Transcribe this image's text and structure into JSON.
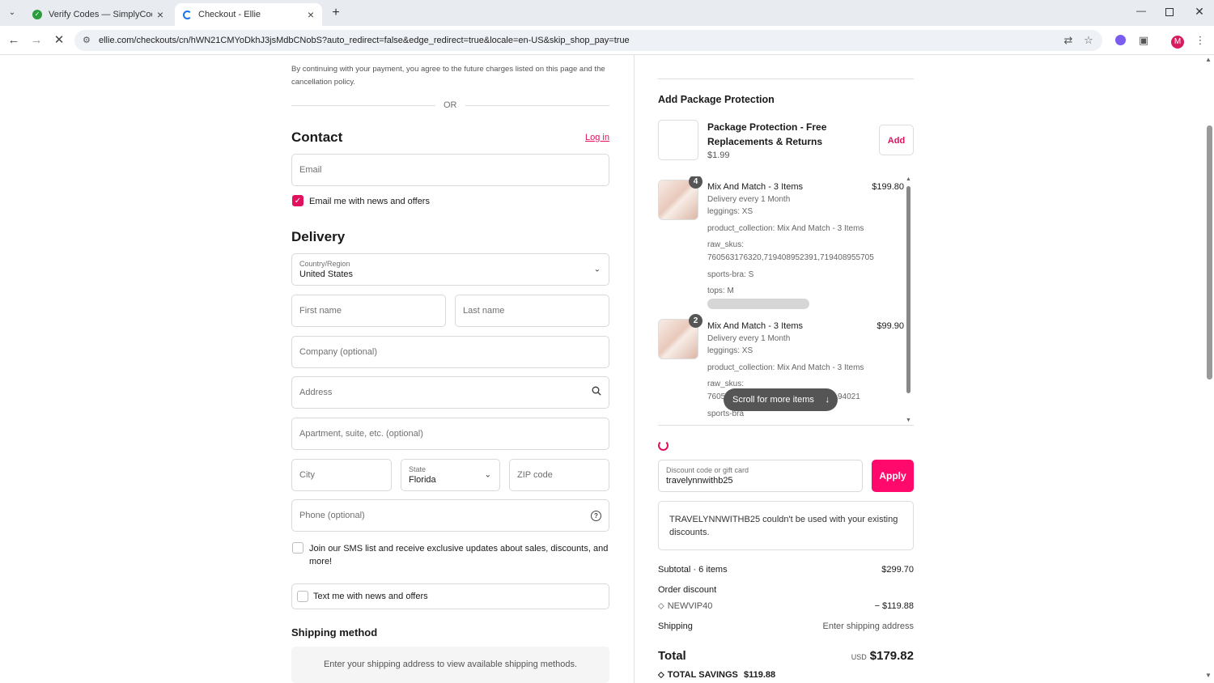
{
  "tabs": [
    {
      "title": "Verify Codes — SimplyCodes",
      "active": false
    },
    {
      "title": "Checkout - Ellie",
      "active": true
    }
  ],
  "url": "ellie.com/checkouts/cn/hWN21CMYoDkhJ3jsMdbCNobS?auto_redirect=false&edge_redirect=true&locale=en-US&skip_shop_pay=true",
  "profile_initial": "M",
  "colors": {
    "accent": "#e0115f",
    "apply_button": "#ff0a6c"
  },
  "left": {
    "consent_text": "By continuing with your payment, you agree to the future charges listed on this page and the cancellation policy.",
    "or_text": "OR",
    "contact": {
      "heading": "Contact",
      "login_link": "Log in",
      "email_placeholder": "Email",
      "email_news_label": "Email me with news and offers",
      "email_news_checked": true
    },
    "delivery": {
      "heading": "Delivery",
      "country_label": "Country/Region",
      "country_value": "United States",
      "first_name_placeholder": "First name",
      "last_name_placeholder": "Last name",
      "company_placeholder": "Company (optional)",
      "address_placeholder": "Address",
      "apartment_placeholder": "Apartment, suite, etc. (optional)",
      "city_placeholder": "City",
      "state_label": "State",
      "state_value": "Florida",
      "zip_placeholder": "ZIP code",
      "phone_placeholder": "Phone (optional)",
      "sms_label": "Join our SMS list and receive exclusive updates about sales, discounts, and more!",
      "text_news_label": "Text me with news and offers"
    },
    "shipping": {
      "heading": "Shipping method",
      "notice": "Enter your shipping address to view available shipping methods."
    }
  },
  "right": {
    "protection": {
      "heading": "Add Package Protection",
      "title": "Package Protection - Free Replacements & Returns",
      "price": "$1.99",
      "add_label": "Add"
    },
    "items": [
      {
        "qty": "4",
        "title": "Mix And Match - 3 Items",
        "price": "$199.80",
        "delivery": "Delivery every 1 Month",
        "leggings": "leggings: XS",
        "collection": "product_collection: Mix And Match - 3 Items",
        "raw_skus_label": "raw_skus:",
        "raw_skus": "760563176320,719408952391,719408955705",
        "sports_bra": "sports-bra: S",
        "tops": "tops: M"
      },
      {
        "qty": "2",
        "title": "Mix And Match - 3 Items",
        "price": "$99.90",
        "delivery": "Delivery every 1 Month",
        "leggings": "leggings: XS",
        "collection": "product_collection: Mix And Match - 3 Items",
        "raw_skus_label": "raw_skus:",
        "raw_skus_start": "7605",
        "raw_skus_end": "94021",
        "sports_bra_partial": "sports-bra"
      }
    ],
    "scroll_more": "Scroll for more items",
    "discount": {
      "label": "Discount code or gift card",
      "value": "travelynnwithb25",
      "apply_label": "Apply",
      "error_code": "TRAVELYNNWITHB25",
      "error_text": " couldn't be used with your existing discounts."
    },
    "summary": {
      "subtotal_label": "Subtotal · 6 items",
      "subtotal_value": "$299.70",
      "order_discount_label": "Order discount",
      "discount_code": "NEWVIP40",
      "discount_value": "− $119.88",
      "shipping_label": "Shipping",
      "shipping_value": "Enter shipping address",
      "total_label": "Total",
      "currency": "USD",
      "total_value": "$179.82",
      "savings_label": "TOTAL SAVINGS",
      "savings_value": "$119.88"
    }
  }
}
